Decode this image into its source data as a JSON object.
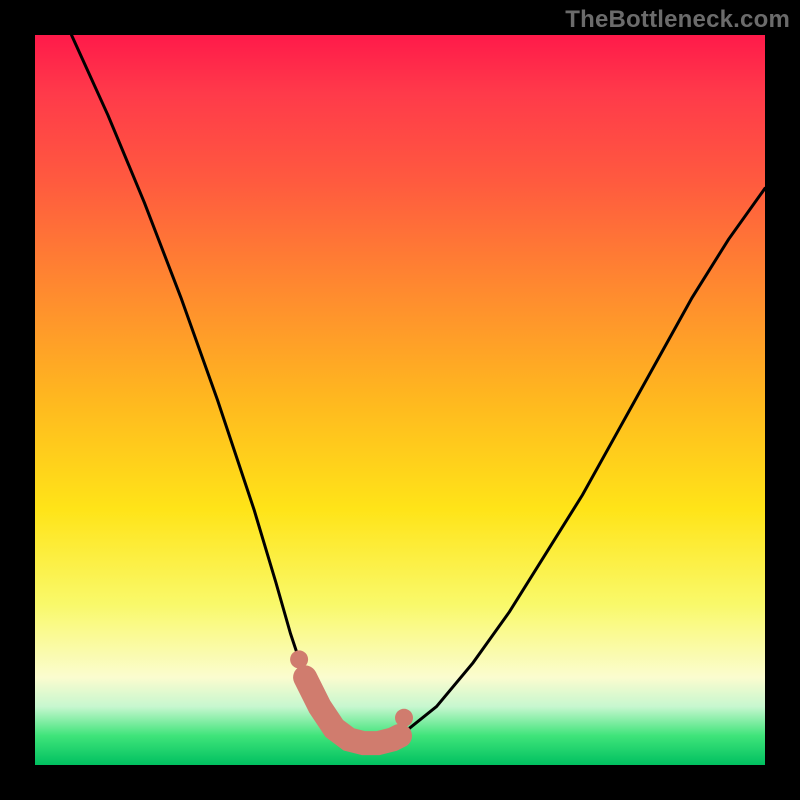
{
  "watermark": "TheBottleneck.com",
  "chart_data": {
    "type": "line",
    "title": "",
    "xlabel": "",
    "ylabel": "",
    "xlim": [
      0,
      1
    ],
    "ylim": [
      0,
      1
    ],
    "series": [
      {
        "name": "bottleneck-curve",
        "x": [
          0.05,
          0.1,
          0.15,
          0.2,
          0.25,
          0.3,
          0.33,
          0.35,
          0.37,
          0.39,
          0.41,
          0.43,
          0.45,
          0.47,
          0.49,
          0.5,
          0.55,
          0.6,
          0.65,
          0.7,
          0.75,
          0.8,
          0.85,
          0.9,
          0.95,
          1.0
        ],
        "y": [
          1.0,
          0.89,
          0.77,
          0.64,
          0.5,
          0.35,
          0.25,
          0.18,
          0.12,
          0.08,
          0.05,
          0.035,
          0.03,
          0.03,
          0.035,
          0.04,
          0.08,
          0.14,
          0.21,
          0.29,
          0.37,
          0.46,
          0.55,
          0.64,
          0.72,
          0.79
        ]
      }
    ],
    "annotations": [
      {
        "type": "highlight",
        "name": "trough-marker",
        "x_range": [
          0.37,
          0.5
        ],
        "color": "#d07c6e"
      }
    ],
    "gradient_stops": [
      {
        "pos": 0.0,
        "color": "#ff1a4a"
      },
      {
        "pos": 0.5,
        "color": "#ffe418"
      },
      {
        "pos": 0.88,
        "color": "#fbfccf"
      },
      {
        "pos": 1.0,
        "color": "#00c060"
      }
    ]
  }
}
